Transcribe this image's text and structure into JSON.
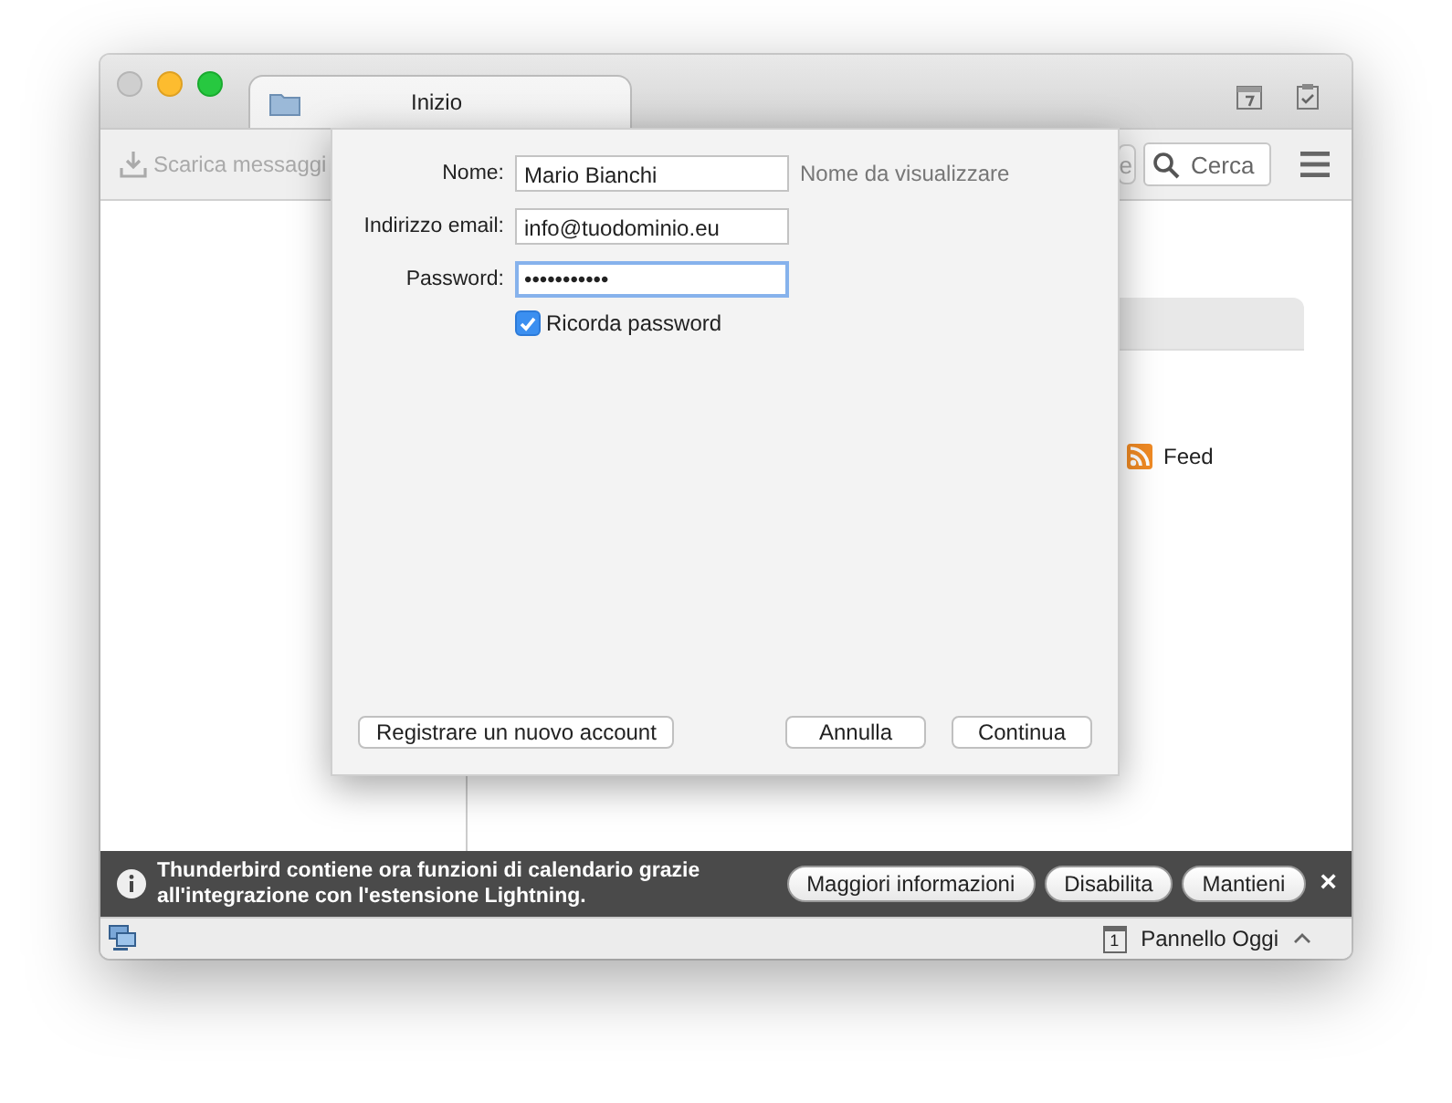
{
  "window": {
    "tabs": [
      {
        "label": "Inizio",
        "selected": true
      }
    ]
  },
  "toolbar": {
    "get_messages": {
      "label": "Scarica messaggi",
      "disabled": true
    },
    "partial_button": "e",
    "search": {
      "placeholder": "Cerca"
    }
  },
  "content": {
    "feed": "Feed"
  },
  "dialog": {
    "fields": [
      {
        "label": "Nome:",
        "value": "Mario Bianchi",
        "note": "Nome da visualizzare",
        "focused": false
      },
      {
        "label": "Indirizzo email:",
        "value": "info@tuodominio.eu",
        "focused": false
      },
      {
        "label": "Password:",
        "value": "•••••••••••",
        "focused": true
      }
    ],
    "remember": {
      "label": "Ricorda password",
      "checked": true
    },
    "left_button": "Registrare un nuovo account",
    "buttons": [
      "Annulla",
      "Continua"
    ]
  },
  "notification": {
    "message": "Thunderbird contiene ora funzioni di calendario grazie all'integrazione con l'estensione Lightning.",
    "buttons": [
      "Maggiori informazioni",
      "Disabilita",
      "Mantieni"
    ],
    "close": "×"
  },
  "status_bar": {
    "today_pane": "Pannello Oggi",
    "today_number": "1"
  }
}
